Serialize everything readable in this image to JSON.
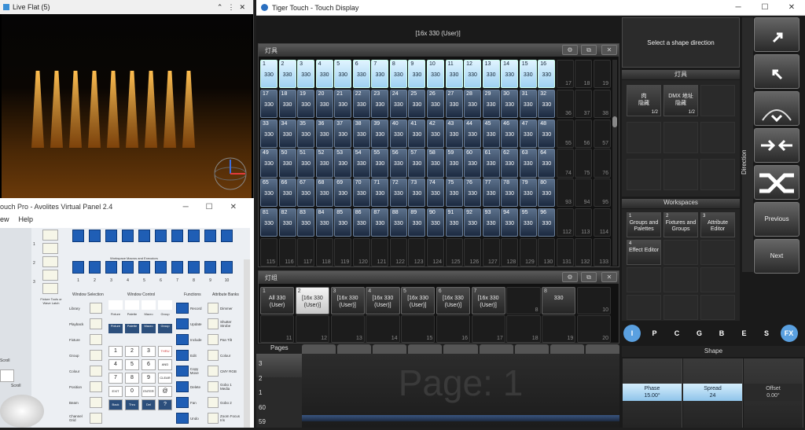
{
  "live_flat": {
    "title": "Live Flat (5)"
  },
  "virtual_panel": {
    "title": "ouch Pro - Avolites Virtual Panel 2.4",
    "menu": [
      "ew",
      "Help"
    ],
    "sections": [
      "Workspace Macros and Executors",
      "Window Selection",
      "Window Control",
      "Functions",
      "Attribute Banks"
    ],
    "window_selection": [
      "Library",
      "Playback",
      "Fixture",
      "Group",
      "Colour",
      "Position",
      "Beam",
      "Channel Grid"
    ],
    "window_control": [
      "View",
      "Min or Max",
      "Size & Position",
      "Close",
      "Fixture",
      "Palette",
      "Macro",
      "Group",
      "Fixture",
      "Palette",
      "Macro",
      "Group"
    ],
    "keypad": [
      "1",
      "2",
      "3",
      "THRU",
      "4",
      "5",
      "6",
      "AND",
      "7",
      "8",
      "9",
      "CLEAR",
      "EXIT",
      "0",
      "ENTER",
      "@",
      "Back",
      "Thru",
      "Del",
      "?"
    ],
    "functions": [
      "Record",
      "Update",
      "Include",
      "Edit",
      "Copy Move",
      "Delete",
      "Fan",
      "Undo"
    ],
    "attribute_banks": [
      "Dimmer",
      "Shutter Strobe",
      "Pan Tilt",
      "Colour",
      "CMY RGB",
      "Gobo 1 Media",
      "Gobo 2",
      "Zoom Focus Iris"
    ],
    "numbers": [
      "1",
      "2",
      "3",
      "4",
      "5",
      "6",
      "7",
      "8",
      "9",
      "10"
    ],
    "scroll_label": "Scroll",
    "scroll_btn": "Scroll",
    "fixture_tools": "Fixture Tools or Wave Latch"
  },
  "tiger": {
    "title": "Tiger Touch - Touch Display",
    "selection": "[16x 330 (User)]",
    "fixtures_title": "灯具",
    "fixtures": [
      {
        "n": "1",
        "v": "330",
        "s": "sel"
      },
      {
        "n": "2",
        "v": "330",
        "s": "sel"
      },
      {
        "n": "3",
        "v": "330",
        "s": "sel"
      },
      {
        "n": "4",
        "v": "330",
        "s": "sel"
      },
      {
        "n": "5",
        "v": "330",
        "s": "sel"
      },
      {
        "n": "6",
        "v": "330",
        "s": "sel"
      },
      {
        "n": "7",
        "v": "330",
        "s": "sel"
      },
      {
        "n": "8",
        "v": "330",
        "s": "sel"
      },
      {
        "n": "9",
        "v": "330",
        "s": "sel"
      },
      {
        "n": "10",
        "v": "330",
        "s": "sel"
      },
      {
        "n": "11",
        "v": "330",
        "s": "sel"
      },
      {
        "n": "12",
        "v": "330",
        "s": "sel"
      },
      {
        "n": "13",
        "v": "330",
        "s": "sel"
      },
      {
        "n": "14",
        "v": "330",
        "s": "sel"
      },
      {
        "n": "15",
        "v": "330",
        "s": "sel"
      },
      {
        "n": "16",
        "v": "330",
        "s": "sel"
      },
      {
        "n": "",
        "v": "",
        "s": "e",
        "b": "17"
      },
      {
        "n": "",
        "v": "",
        "s": "e",
        "b": "18"
      },
      {
        "n": "",
        "v": "",
        "s": "e",
        "b": "19"
      },
      {
        "n": "17",
        "v": "330",
        "s": "d"
      },
      {
        "n": "18",
        "v": "330",
        "s": "d"
      },
      {
        "n": "19",
        "v": "330",
        "s": "d"
      },
      {
        "n": "20",
        "v": "330",
        "s": "d"
      },
      {
        "n": "21",
        "v": "330",
        "s": "d"
      },
      {
        "n": "22",
        "v": "330",
        "s": "d"
      },
      {
        "n": "23",
        "v": "330",
        "s": "d"
      },
      {
        "n": "24",
        "v": "330",
        "s": "d"
      },
      {
        "n": "25",
        "v": "330",
        "s": "d"
      },
      {
        "n": "26",
        "v": "330",
        "s": "d"
      },
      {
        "n": "27",
        "v": "330",
        "s": "d"
      },
      {
        "n": "28",
        "v": "330",
        "s": "d"
      },
      {
        "n": "29",
        "v": "330",
        "s": "d"
      },
      {
        "n": "30",
        "v": "330",
        "s": "d"
      },
      {
        "n": "31",
        "v": "330",
        "s": "d"
      },
      {
        "n": "32",
        "v": "330",
        "s": "d"
      },
      {
        "n": "",
        "v": "",
        "s": "e",
        "b": "36"
      },
      {
        "n": "",
        "v": "",
        "s": "e",
        "b": "37"
      },
      {
        "n": "",
        "v": "",
        "s": "e",
        "b": "38"
      },
      {
        "n": "33",
        "v": "330",
        "s": "d"
      },
      {
        "n": "34",
        "v": "330",
        "s": "d"
      },
      {
        "n": "35",
        "v": "330",
        "s": "d"
      },
      {
        "n": "36",
        "v": "330",
        "s": "d"
      },
      {
        "n": "37",
        "v": "330",
        "s": "d"
      },
      {
        "n": "38",
        "v": "330",
        "s": "d"
      },
      {
        "n": "39",
        "v": "330",
        "s": "d"
      },
      {
        "n": "40",
        "v": "330",
        "s": "d"
      },
      {
        "n": "41",
        "v": "330",
        "s": "d"
      },
      {
        "n": "42",
        "v": "330",
        "s": "d"
      },
      {
        "n": "43",
        "v": "330",
        "s": "d"
      },
      {
        "n": "44",
        "v": "330",
        "s": "d"
      },
      {
        "n": "45",
        "v": "330",
        "s": "d"
      },
      {
        "n": "46",
        "v": "330",
        "s": "d"
      },
      {
        "n": "47",
        "v": "330",
        "s": "d"
      },
      {
        "n": "48",
        "v": "330",
        "s": "d"
      },
      {
        "n": "",
        "v": "",
        "s": "e",
        "b": "55"
      },
      {
        "n": "",
        "v": "",
        "s": "e",
        "b": "56"
      },
      {
        "n": "",
        "v": "",
        "s": "e",
        "b": "57"
      },
      {
        "n": "49",
        "v": "330",
        "s": "d"
      },
      {
        "n": "50",
        "v": "330",
        "s": "d"
      },
      {
        "n": "51",
        "v": "330",
        "s": "d"
      },
      {
        "n": "52",
        "v": "330",
        "s": "d"
      },
      {
        "n": "53",
        "v": "330",
        "s": "d"
      },
      {
        "n": "54",
        "v": "330",
        "s": "d"
      },
      {
        "n": "55",
        "v": "330",
        "s": "d"
      },
      {
        "n": "56",
        "v": "330",
        "s": "d"
      },
      {
        "n": "57",
        "v": "330",
        "s": "d"
      },
      {
        "n": "58",
        "v": "330",
        "s": "d"
      },
      {
        "n": "59",
        "v": "330",
        "s": "d"
      },
      {
        "n": "60",
        "v": "330",
        "s": "d"
      },
      {
        "n": "61",
        "v": "330",
        "s": "d"
      },
      {
        "n": "62",
        "v": "330",
        "s": "d"
      },
      {
        "n": "63",
        "v": "330",
        "s": "d"
      },
      {
        "n": "64",
        "v": "330",
        "s": "d"
      },
      {
        "n": "",
        "v": "",
        "s": "e",
        "b": "74"
      },
      {
        "n": "",
        "v": "",
        "s": "e",
        "b": "75"
      },
      {
        "n": "",
        "v": "",
        "s": "e",
        "b": "76"
      },
      {
        "n": "65",
        "v": "330",
        "s": "d"
      },
      {
        "n": "66",
        "v": "330",
        "s": "d"
      },
      {
        "n": "67",
        "v": "330",
        "s": "d"
      },
      {
        "n": "68",
        "v": "330",
        "s": "d"
      },
      {
        "n": "69",
        "v": "330",
        "s": "d"
      },
      {
        "n": "70",
        "v": "330",
        "s": "d"
      },
      {
        "n": "71",
        "v": "330",
        "s": "d"
      },
      {
        "n": "72",
        "v": "330",
        "s": "d"
      },
      {
        "n": "73",
        "v": "330",
        "s": "d"
      },
      {
        "n": "74",
        "v": "330",
        "s": "d"
      },
      {
        "n": "75",
        "v": "330",
        "s": "d"
      },
      {
        "n": "76",
        "v": "330",
        "s": "d"
      },
      {
        "n": "77",
        "v": "330",
        "s": "d"
      },
      {
        "n": "78",
        "v": "330",
        "s": "d"
      },
      {
        "n": "79",
        "v": "330",
        "s": "d"
      },
      {
        "n": "80",
        "v": "330",
        "s": "d"
      },
      {
        "n": "",
        "v": "",
        "s": "e",
        "b": "93"
      },
      {
        "n": "",
        "v": "",
        "s": "e",
        "b": "94"
      },
      {
        "n": "",
        "v": "",
        "s": "e",
        "b": "95"
      },
      {
        "n": "81",
        "v": "330",
        "s": "d"
      },
      {
        "n": "82",
        "v": "330",
        "s": "d"
      },
      {
        "n": "83",
        "v": "330",
        "s": "d"
      },
      {
        "n": "84",
        "v": "330",
        "s": "d"
      },
      {
        "n": "85",
        "v": "330",
        "s": "d"
      },
      {
        "n": "86",
        "v": "330",
        "s": "d"
      },
      {
        "n": "87",
        "v": "330",
        "s": "d"
      },
      {
        "n": "88",
        "v": "330",
        "s": "d"
      },
      {
        "n": "89",
        "v": "330",
        "s": "d"
      },
      {
        "n": "90",
        "v": "330",
        "s": "d"
      },
      {
        "n": "91",
        "v": "330",
        "s": "d"
      },
      {
        "n": "92",
        "v": "330",
        "s": "d"
      },
      {
        "n": "93",
        "v": "330",
        "s": "d"
      },
      {
        "n": "94",
        "v": "330",
        "s": "d"
      },
      {
        "n": "95",
        "v": "330",
        "s": "d"
      },
      {
        "n": "96",
        "v": "330",
        "s": "d"
      },
      {
        "n": "",
        "v": "",
        "s": "e",
        "b": "112"
      },
      {
        "n": "",
        "v": "",
        "s": "e",
        "b": "113"
      },
      {
        "n": "",
        "v": "",
        "s": "e",
        "b": "114"
      },
      {
        "n": "",
        "v": "",
        "s": "e",
        "b": "115"
      },
      {
        "n": "",
        "v": "",
        "s": "e",
        "b": "116"
      },
      {
        "n": "",
        "v": "",
        "s": "e",
        "b": "117"
      },
      {
        "n": "",
        "v": "",
        "s": "e",
        "b": "118"
      },
      {
        "n": "",
        "v": "",
        "s": "e",
        "b": "119"
      },
      {
        "n": "",
        "v": "",
        "s": "e",
        "b": "120"
      },
      {
        "n": "",
        "v": "",
        "s": "e",
        "b": "121"
      },
      {
        "n": "",
        "v": "",
        "s": "e",
        "b": "122"
      },
      {
        "n": "",
        "v": "",
        "s": "e",
        "b": "123"
      },
      {
        "n": "",
        "v": "",
        "s": "e",
        "b": "124"
      },
      {
        "n": "",
        "v": "",
        "s": "e",
        "b": "125"
      },
      {
        "n": "",
        "v": "",
        "s": "e",
        "b": "126"
      },
      {
        "n": "",
        "v": "",
        "s": "e",
        "b": "127"
      },
      {
        "n": "",
        "v": "",
        "s": "e",
        "b": "128"
      },
      {
        "n": "",
        "v": "",
        "s": "e",
        "b": "129"
      },
      {
        "n": "",
        "v": "",
        "s": "e",
        "b": "130"
      },
      {
        "n": "",
        "v": "",
        "s": "e",
        "b": "131"
      },
      {
        "n": "",
        "v": "",
        "s": "e",
        "b": "132"
      },
      {
        "n": "",
        "v": "",
        "s": "e",
        "b": "133"
      }
    ],
    "groups_title": "灯组",
    "groups": [
      {
        "n": "1",
        "t": "All 330\n(User)"
      },
      {
        "n": "2",
        "t": "[16x 330\n(User)]",
        "sel": true
      },
      {
        "n": "3",
        "t": "[16x 330\n(User)]"
      },
      {
        "n": "4",
        "t": "[16x 330\n(User)]"
      },
      {
        "n": "5",
        "t": "[16x 330\n(User)]"
      },
      {
        "n": "6",
        "t": "[16x 330\n(User)]"
      },
      {
        "n": "7",
        "t": "[16x 330\n(User)]"
      },
      {
        "n": "",
        "t": "",
        "b": "8"
      },
      {
        "n": "8",
        "t": "330"
      },
      {
        "n": "",
        "t": "",
        "b": "10"
      },
      {
        "n": "",
        "t": "",
        "b": "11"
      },
      {
        "n": "",
        "t": "",
        "b": "12"
      },
      {
        "n": "",
        "t": "",
        "b": "13"
      },
      {
        "n": "",
        "t": "",
        "b": "14"
      },
      {
        "n": "",
        "t": "",
        "b": "15"
      },
      {
        "n": "",
        "t": "",
        "b": "16"
      },
      {
        "n": "",
        "t": "",
        "b": "17"
      },
      {
        "n": "",
        "t": "",
        "b": "18"
      },
      {
        "n": "",
        "t": "",
        "b": "19"
      },
      {
        "n": "",
        "t": "",
        "b": "20"
      }
    ],
    "pages_label": "Pages",
    "page_numbers": [
      "3",
      "2",
      "1",
      "60",
      "59"
    ],
    "page_big": "Page: 1",
    "shape_prompt": "Select a shape direction",
    "fixture_types_title": "灯具",
    "fixture_types": [
      {
        "label": "肉\n隐藏",
        "count": "1/2"
      },
      {
        "label": "DMX 地址\n隐藏",
        "count": "1/2"
      }
    ],
    "workspaces_title": "Workspaces",
    "workspaces": [
      {
        "n": "1",
        "label": "Groups and Palettes"
      },
      {
        "n": "2",
        "label": "Fixtures and Groups"
      },
      {
        "n": "3",
        "label": "Attribute Editor"
      },
      {
        "n": "4",
        "label": "Effect Editor"
      }
    ],
    "direction_label": "Direction",
    "nav": {
      "previous": "Previous",
      "next": "Next"
    },
    "attr_tabs": [
      "I",
      "P",
      "C",
      "G",
      "B",
      "E",
      "S",
      "FX"
    ],
    "shape_title": "Shape",
    "shape_params": [
      {
        "name": "Phase",
        "value": "15.00°"
      },
      {
        "name": "Spread",
        "value": "24"
      },
      {
        "name": "Offset",
        "value": "0.00°"
      }
    ]
  }
}
